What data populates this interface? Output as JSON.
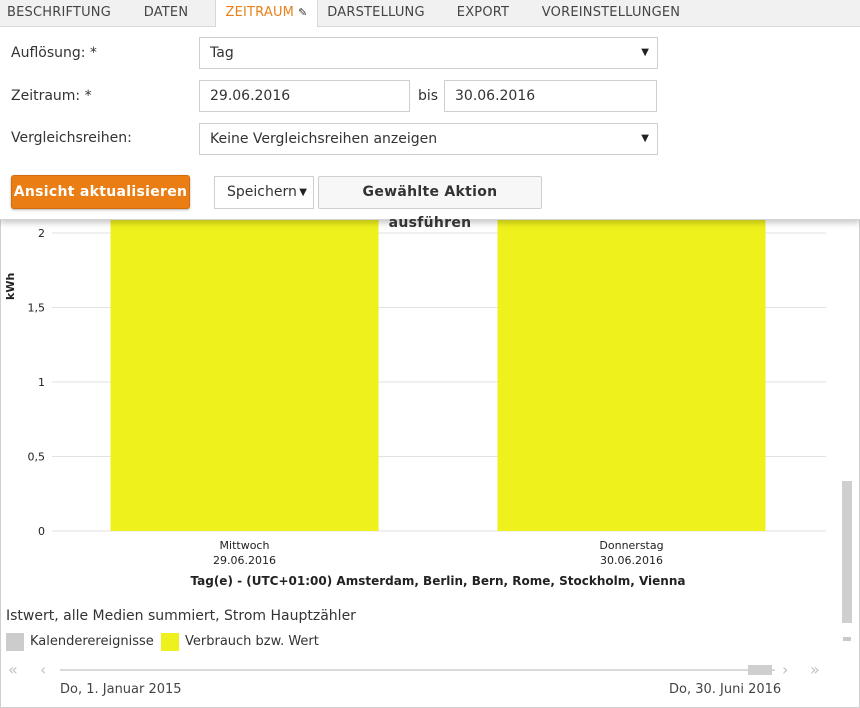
{
  "tabs": [
    {
      "label": "BESCHRIFTUNG"
    },
    {
      "label": "DATEN"
    },
    {
      "label": "ZEITRAUM"
    },
    {
      "label": "DARSTELLUNG"
    },
    {
      "label": "EXPORT"
    },
    {
      "label": "VOREINSTELLUNGEN"
    }
  ],
  "form": {
    "aufloesung_label": "Auflösung: *",
    "aufloesung_value": "Tag",
    "zeitraum_label": "Zeitraum: *",
    "from_value": "29.06.2016",
    "bis_label": "bis",
    "to_value": "30.06.2016",
    "vergleich_label": "Vergleichsreihen:",
    "vergleich_value": "Keine Vergleichsreihen anzeigen",
    "update_button": "Ansicht aktualisieren",
    "action_select": "Speichern",
    "execute_button": "Gewählte Aktion ausführen"
  },
  "colors": {
    "accent": "#ea7d13",
    "bar": "#eef11c",
    "calendar": "#cccccc"
  },
  "chart_data": {
    "type": "bar",
    "categories": [
      "Mittwoch\n29.06.2016",
      "Donnerstag\n30.06.2016"
    ],
    "category_lines": [
      [
        "Mittwoch",
        "29.06.2016"
      ],
      [
        "Donnerstag",
        "30.06.2016"
      ]
    ],
    "series": [
      {
        "name": "Verbrauch bzw. Wert",
        "values": [
          2.2,
          2.2
        ]
      }
    ],
    "ylabel": "kWh",
    "xlabel": "Tag(e) - (UTC+01:00) Amsterdam, Berlin, Bern, Rome, Stockholm, Vienna",
    "yticks": [
      0,
      0.5,
      1,
      1.5,
      2
    ],
    "ytick_labels": [
      "0",
      "0,5",
      "1",
      "1,5",
      "2"
    ],
    "ylim": [
      0,
      2.2
    ],
    "grid": true
  },
  "legend": {
    "series_title": "Istwert, alle Medien summiert, Strom Hauptzähler",
    "items": [
      {
        "label": "Kalenderereignisse",
        "color": "#cccccc"
      },
      {
        "label": "Verbrauch bzw. Wert",
        "color": "#eef11c"
      }
    ]
  },
  "timeline": {
    "start_label": "Do, 1. Januar 2015",
    "end_label": "Do, 30. Juni 2016"
  }
}
